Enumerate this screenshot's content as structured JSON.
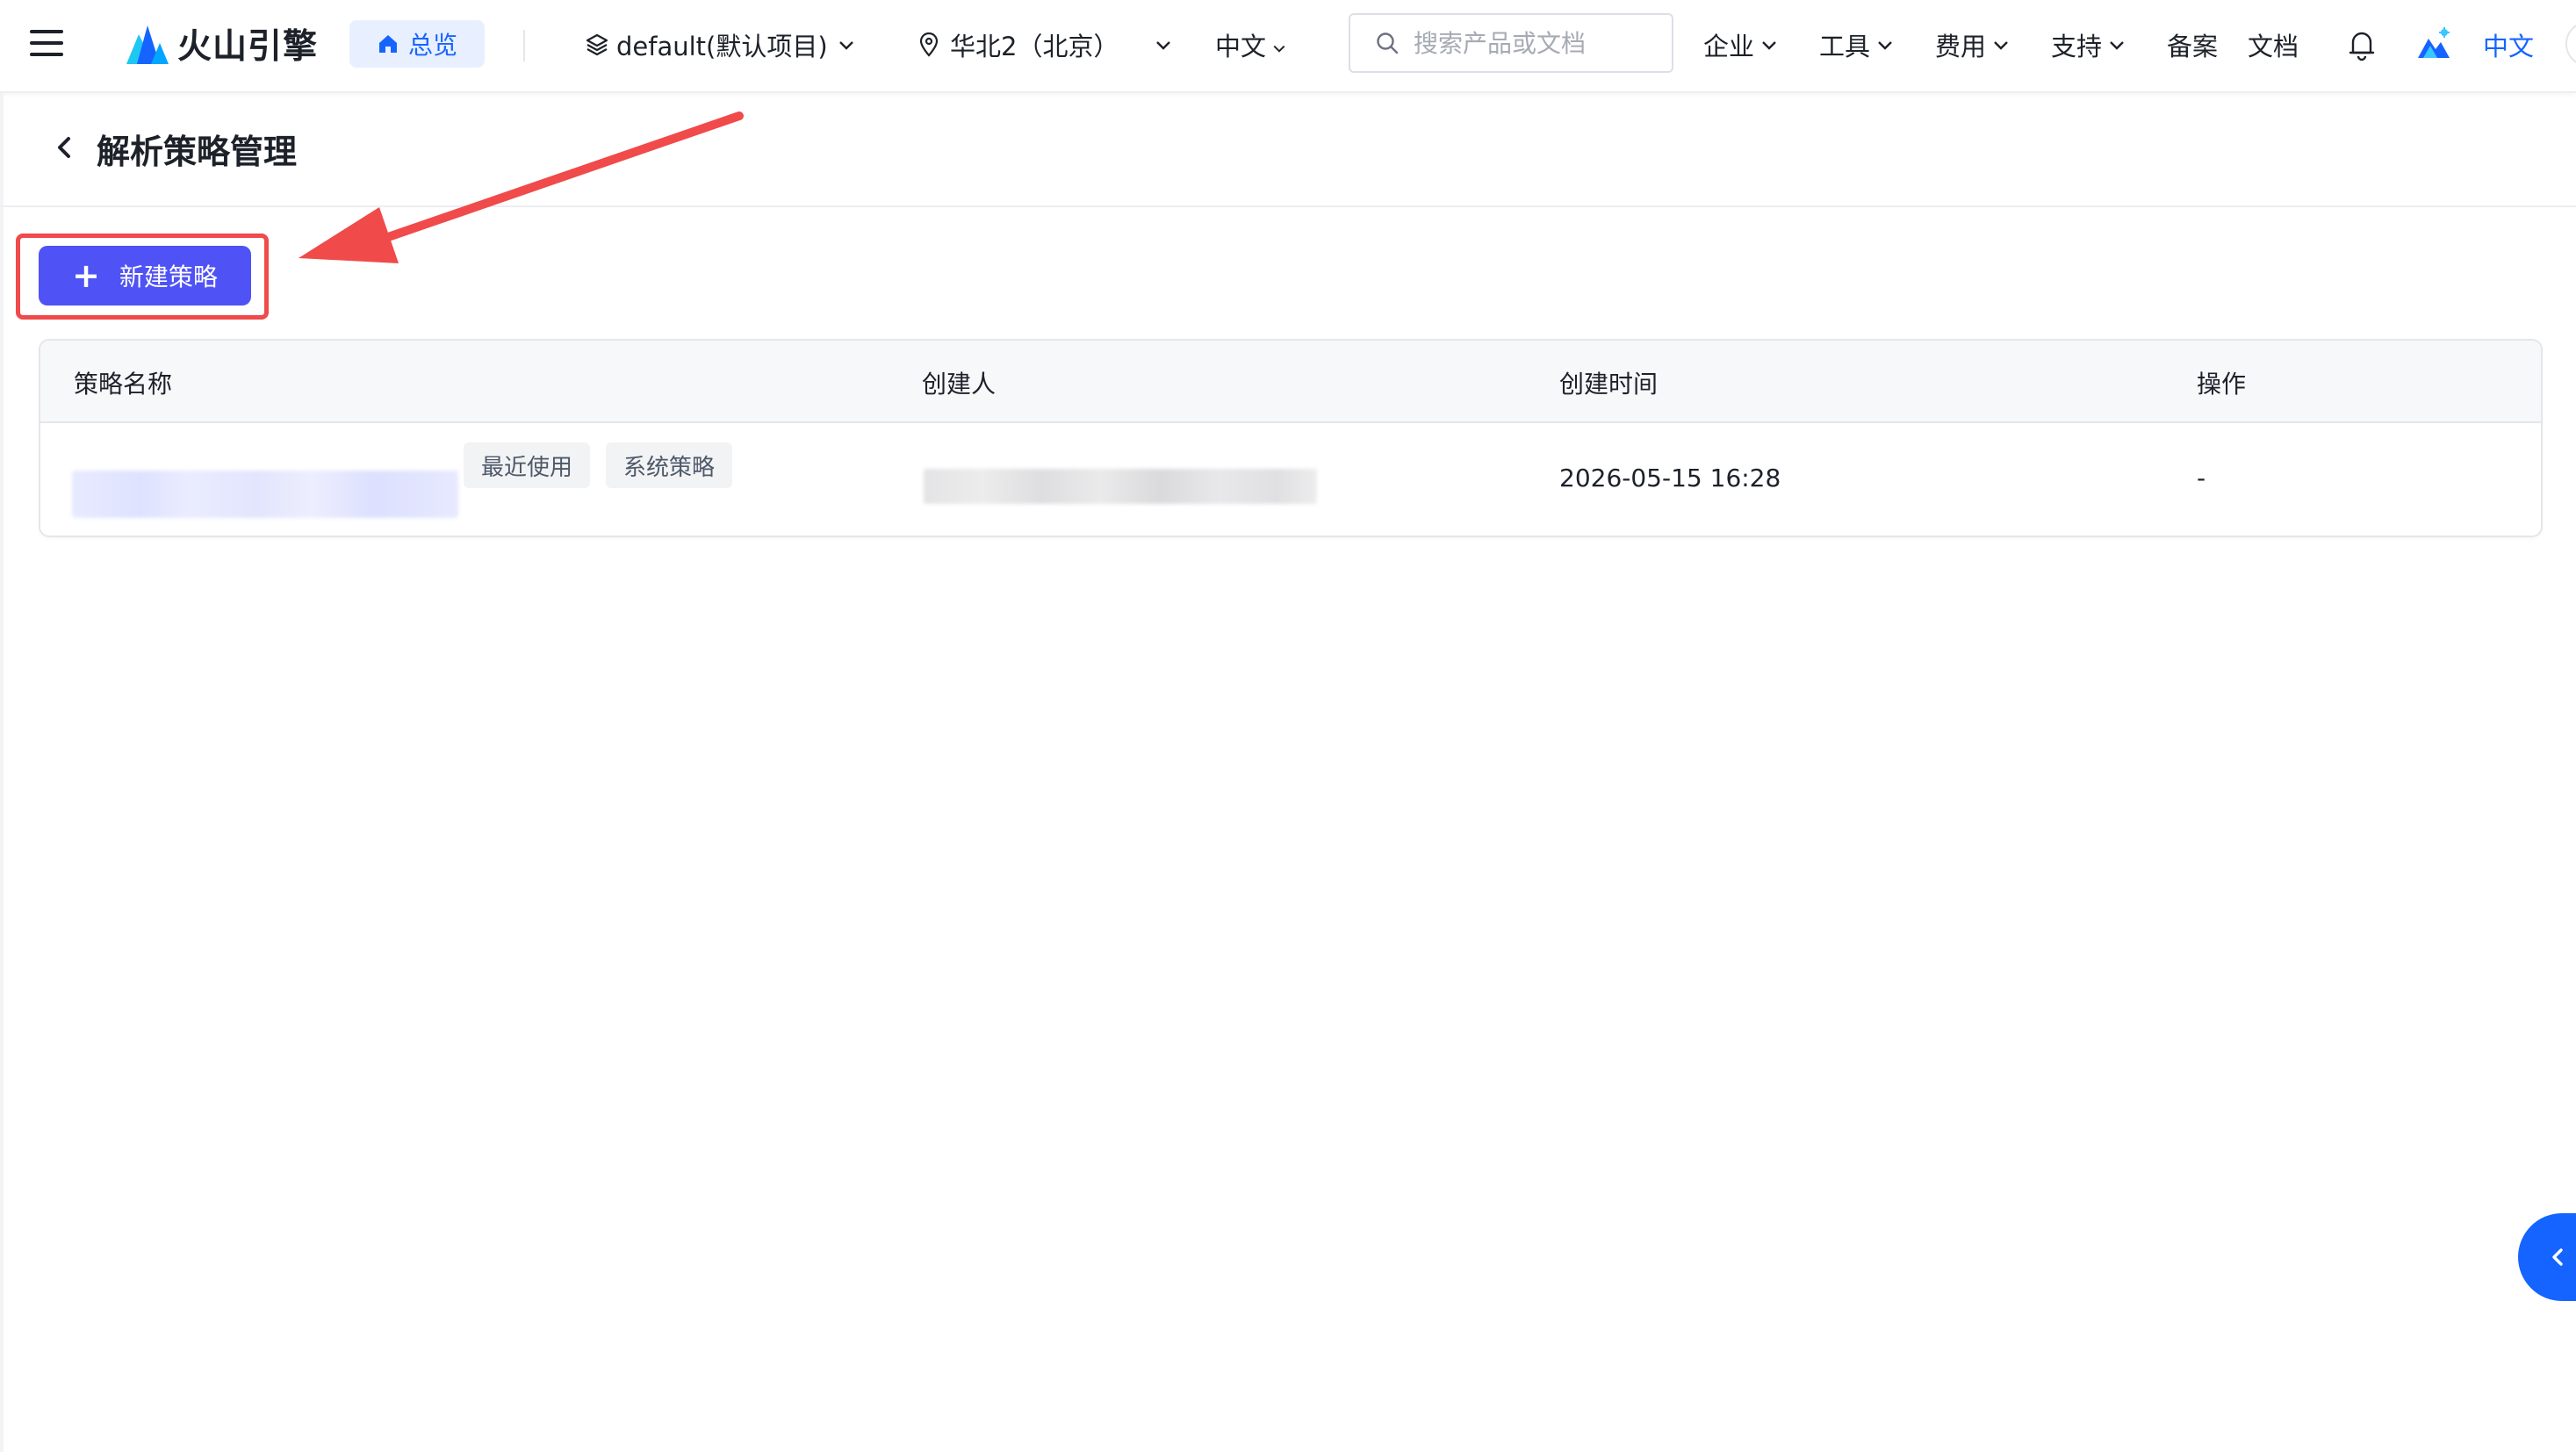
{
  "header": {
    "brand_name": "火山引擎",
    "overview_label": "总览",
    "project_selector": "default(默认项目)",
    "region_selector": "华北2（北京）",
    "language_selector": "中文",
    "search": {
      "placeholder": "搜索产品或文档"
    },
    "nav": {
      "enterprise": "企业",
      "tools": "工具",
      "billing": "费用",
      "support": "支持",
      "filing": "备案",
      "docs": "文档"
    },
    "language_short": "中文"
  },
  "page": {
    "title": "解析策略管理",
    "create_button_label": "新建策略"
  },
  "table": {
    "columns": [
      "策略名称",
      "创建人",
      "创建时间",
      "操作"
    ],
    "rows": [
      {
        "tags": [
          "最近使用",
          "系统策略"
        ],
        "created_time": "2026-05-15 16:28",
        "action": "-"
      }
    ]
  },
  "colors": {
    "primary": "#1664ff",
    "create_button": "#4f52f4",
    "annotation_red": "#f04a4a"
  }
}
